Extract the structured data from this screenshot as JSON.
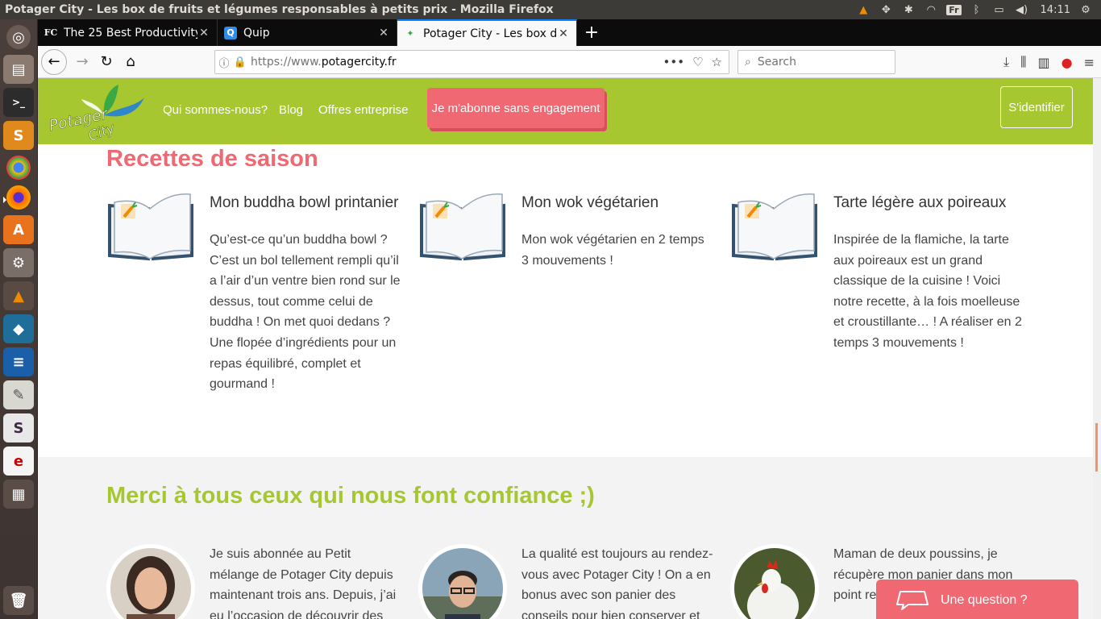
{
  "os": {
    "window_title": "Potager City - Les box de fruits et légumes responsables à petits prix - Mozilla Firefox",
    "tray": {
      "lang": "Fr",
      "clock": "14:11"
    }
  },
  "browser": {
    "tabs": [
      {
        "label": "The 25 Best Productivity",
        "favicon": "FC"
      },
      {
        "label": "Quip",
        "favicon": "Q"
      },
      {
        "label": "Potager City - Les box de",
        "favicon": "leaf"
      }
    ],
    "url": {
      "proto": "https://www.",
      "domain": "potagercity.fr"
    },
    "search_placeholder": "Search"
  },
  "site": {
    "nav": [
      "Qui sommes-nous?",
      "Blog",
      "Offres entreprise"
    ],
    "cta_label": "Je m'abonne sans engagement",
    "login_label": "S'identifier",
    "logo_text": "Potager City",
    "recipes_heading": "Recettes de saison",
    "recipes": [
      {
        "title": "Mon buddha bowl printanier",
        "text": "Qu’est-ce qu’un buddha bowl ? C’est un bol tellement rempli qu’il a l’air d’un ventre bien rond sur le dessus, tout comme celui de buddha ! On met quoi dedans ? Une flopée d’ingrédients pour un repas équilibré, complet et gourmand !"
      },
      {
        "title": "Mon wok végétarien",
        "text": "Mon wok végétarien en 2 temps 3 mouvements !"
      },
      {
        "title": "Tarte légère aux poireaux",
        "text": "Inspirée de la flamiche, la tarte aux poireaux est un grand classique de la cuisine ! Voici notre recette, à la fois moelleuse et croustillante… ! A réaliser en 2 temps 3 mouvements !"
      }
    ],
    "testimonials_heading": "Merci à tous ceux qui nous font confiance ;)",
    "testimonials": [
      {
        "text": "Je suis abonnée au Petit mélange de Potager City depuis maintenant trois ans. Depuis, j’ai eu l’occasion de découvrir des fruits et légumes"
      },
      {
        "text": "La qualité est toujours au rendez-vous avec Potager City ! On a en bonus avec son panier des conseils pour bien conserver et cuisiner les"
      },
      {
        "text": "Maman de deux poussins, je récupère mon panier dans mon point relais Potager"
      }
    ],
    "help_label": "Une question ?"
  },
  "colors": {
    "brand_green": "#a6c72f",
    "brand_pink": "#ef6872"
  }
}
